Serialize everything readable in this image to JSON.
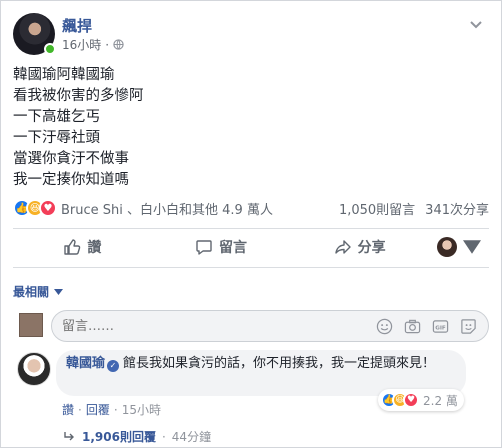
{
  "post": {
    "author": "飆捍",
    "time": "16小時",
    "dot": "·",
    "lines": [
      "韓國瑜阿韓國瑜",
      "看我被你害的多慘阿",
      "一下高雄乞丐",
      "一下汙辱社頭",
      "當選你貪汙不做事",
      "我一定揍你知道嗎"
    ]
  },
  "reactions": {
    "names": "Bruce Shi 、白小白和其他 4.9 萬人",
    "comments": "1,050則留言",
    "shares": "341次分享"
  },
  "actions": {
    "like": "讚",
    "comment": "留言",
    "share": "分享"
  },
  "sort": {
    "label": "最相關"
  },
  "composer": {
    "placeholder": "留言……"
  },
  "comment": {
    "author": "韓國瑜",
    "text": "館長我如果貪污的話，你不用揍我，我一定提頭來見！",
    "reaction_count": "2.2 萬",
    "like": "讚",
    "reply": "回覆",
    "time": "15小時",
    "dot": "·"
  },
  "replies": {
    "count": "1,906則回覆",
    "time": "44分鐘",
    "dot": "·"
  },
  "colors": {
    "link": "#385898",
    "like_blue": "#1877f2",
    "online": "#42b72a"
  }
}
